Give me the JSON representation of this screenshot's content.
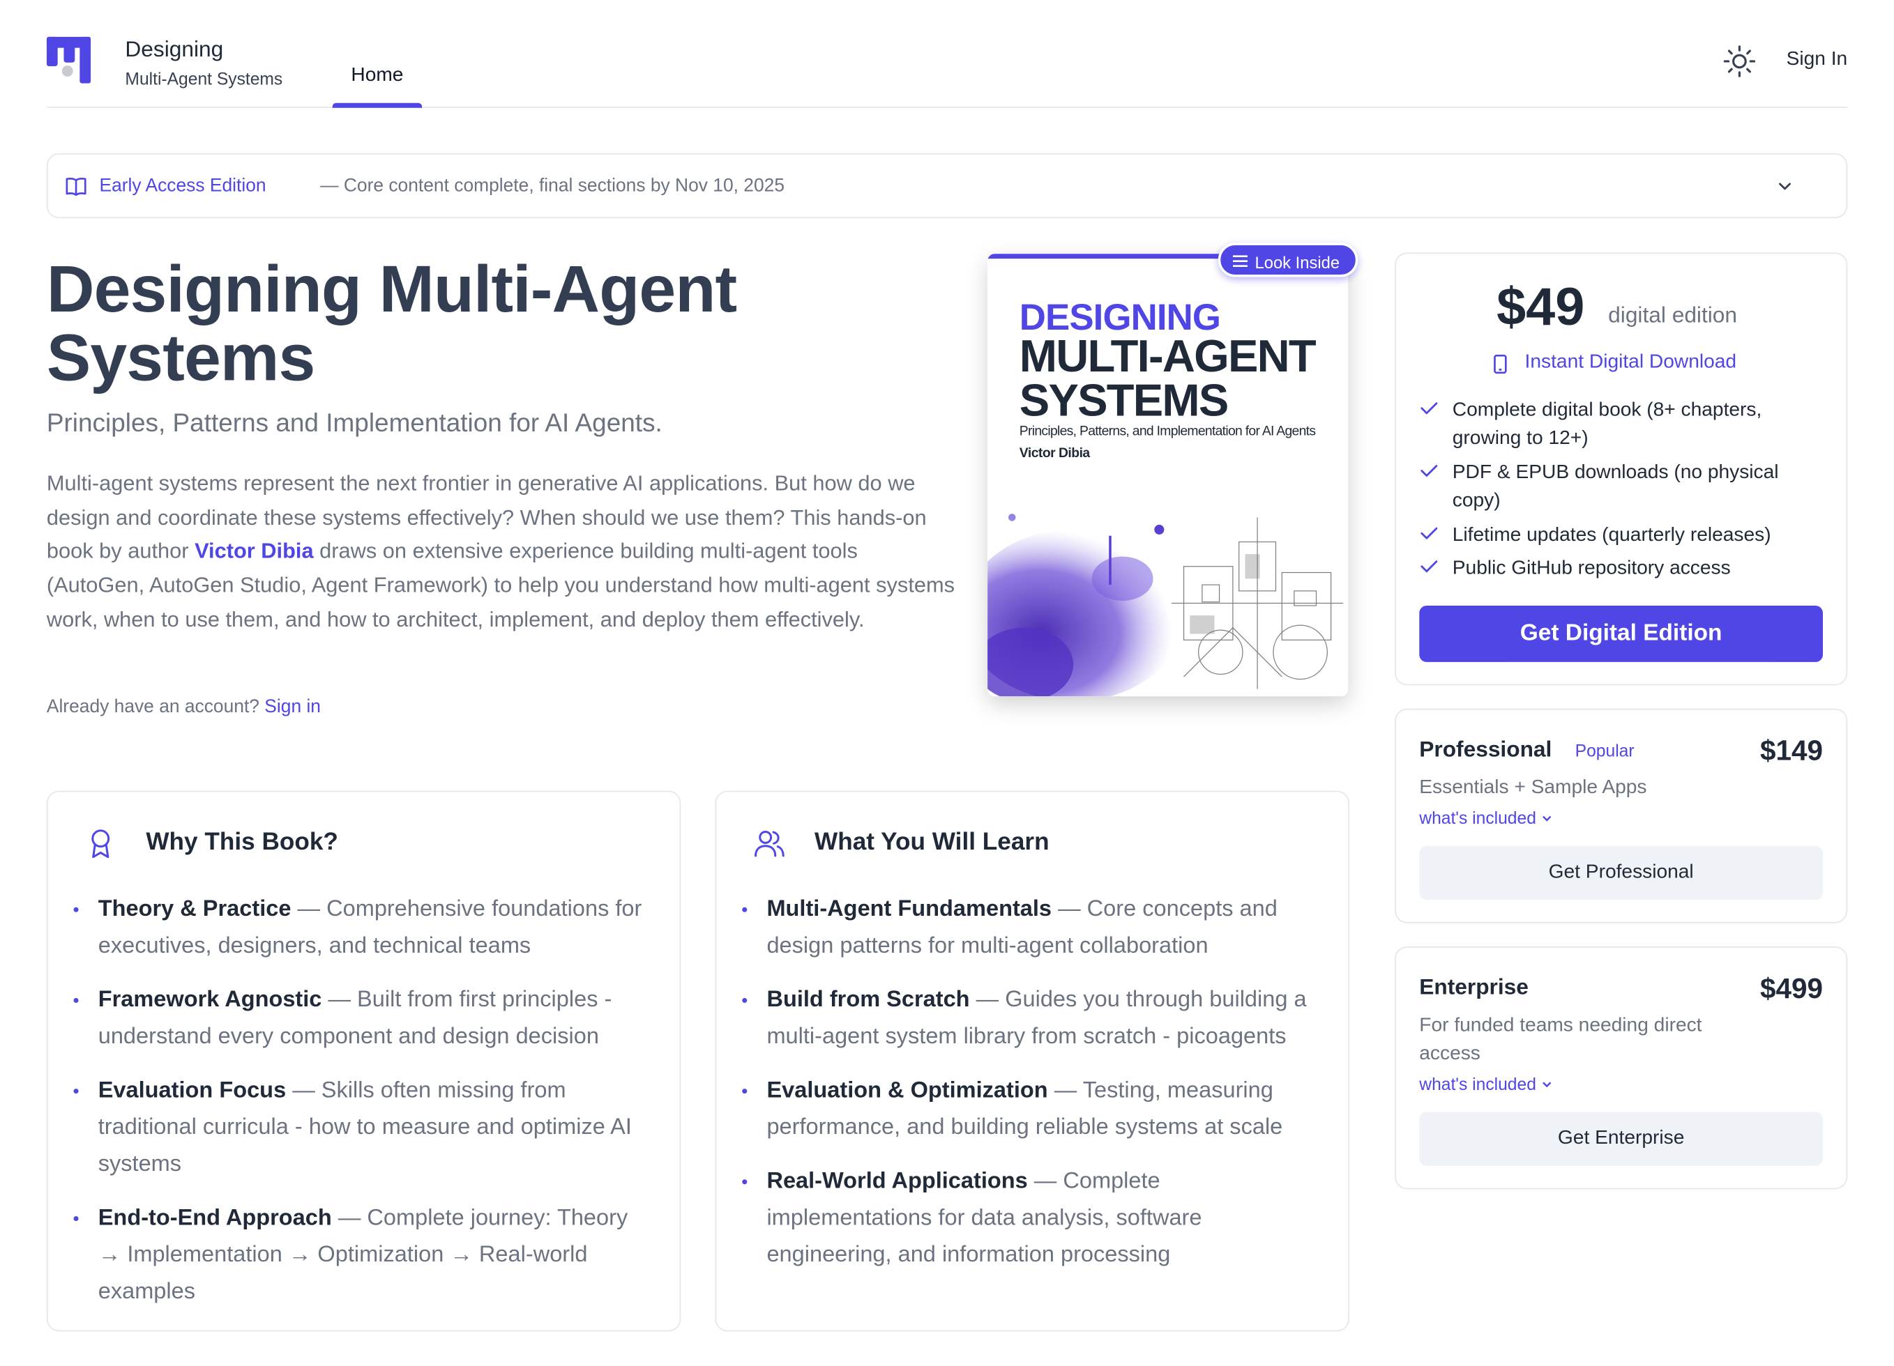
{
  "header": {
    "brand_title": "Designing",
    "brand_subtitle": "Multi-Agent Systems",
    "nav_home": "Home",
    "sign_in": "Sign In",
    "logo_icon": "book-logo-icon",
    "theme_icon": "sun-icon"
  },
  "banner": {
    "label": "Early Access Edition",
    "text": "— Core content complete, final sections by Nov 10, 2025",
    "icon": "book-open-icon"
  },
  "hero": {
    "title_line1": "Designing Multi-Agent",
    "title_line2": "Systems",
    "subtitle": "Principles, Patterns and Implementation for AI Agents.",
    "desc_part1": "Multi-agent systems represent the next frontier in generative AI applications. But how do we design and coordinate these systems effectively? When should we use them? This hands-on book by author ",
    "desc_author": "Victor Dibia",
    "desc_part2": " draws on extensive experience building multi-agent tools (AutoGen, AutoGen Studio, Agent Framework) to help you understand how multi-agent systems work, when to use them, and how to architect, implement, and deploy them effectively.",
    "account_text": "Already have an account?",
    "account_link": "Sign in"
  },
  "cover": {
    "line1": "DESIGNING",
    "line2": "MULTI-AGENT",
    "line3": "SYSTEMS",
    "subtitle": "Principles, Patterns, and Implementation for AI Agents",
    "author": "Victor Dibia",
    "look_inside": "Look Inside"
  },
  "why": {
    "title": "Why This Book?",
    "items": [
      {
        "title": "Theory & Practice",
        "text": " — Comprehensive foundations for executives, designers, and technical teams"
      },
      {
        "title": "Framework Agnostic",
        "text": " — Built from first principles - understand every component and design decision"
      },
      {
        "title": "Evaluation Focus",
        "text": " — Skills often missing from traditional curricula - how to measure and optimize AI systems"
      },
      {
        "title": "End-to-End Approach",
        "text": " — Complete journey: Theory → Implementation → Optimization → Real-world examples"
      }
    ]
  },
  "learn": {
    "title": "What You Will Learn",
    "items": [
      {
        "title": "Multi-Agent Fundamentals",
        "text": " — Core concepts and design patterns for multi-agent collaboration"
      },
      {
        "title": "Build from Scratch",
        "text": " — Guides you through building a multi-agent system library from scratch - picoagents"
      },
      {
        "title": "Evaluation & Optimization",
        "text": " — Testing, measuring performance, and building reliable systems at scale"
      },
      {
        "title": "Real-World Applications",
        "text": " — Complete implementations for data analysis, software engineering, and information processing"
      }
    ]
  },
  "pricing": {
    "digital": {
      "price": "$49",
      "note": "digital edition",
      "instant": "Instant Digital Download",
      "features": [
        "Complete digital book (8+ chapters, growing to 12+)",
        "PDF & EPUB downloads (no physical copy)",
        "Lifetime updates (quarterly releases)",
        "Public GitHub repository access"
      ],
      "button": "Get Digital Edition"
    },
    "professional": {
      "name": "Professional",
      "badge": "Popular",
      "price": "$149",
      "desc": "Essentials + Sample Apps",
      "more": "what's included",
      "button": "Get Professional"
    },
    "enterprise": {
      "name": "Enterprise",
      "price": "$499",
      "desc": "For funded teams needing direct access",
      "more": "what's included",
      "button": "Get Enterprise"
    }
  },
  "colors": {
    "accent": "#4f46e5",
    "text": "#1f2937",
    "muted": "#6b7280",
    "border": "#e5e7eb"
  }
}
